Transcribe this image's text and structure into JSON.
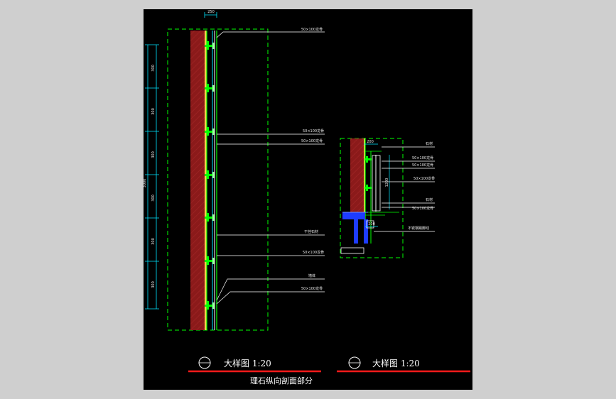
{
  "colors": {
    "background": "#cfcfcf",
    "sheet": "#000000",
    "cut_line": "#00ff00",
    "dim_line": "#00e5ff",
    "label": "#e8e8e8",
    "wall_hatch": "#8b1a1a",
    "steel_channel": "#1e3cff",
    "title_underline": "#ff1a1a"
  },
  "left_detail": {
    "top_dimension": "250",
    "total_dimension": "3000",
    "spacing_labels": [
      "300",
      "300",
      "300",
      "300",
      "300",
      "300"
    ],
    "callouts": [
      "50×100龙骨",
      "50×100龙骨",
      "50×100龙骨",
      "干挂石材",
      "50×100龙骨",
      "墙体",
      "50×100龙骨"
    ],
    "title": "大样图  1:20"
  },
  "right_detail": {
    "top_dimension": "200",
    "side_dimension": "1200",
    "bottom_dimension": "200",
    "callouts": [
      "石材",
      "50×100龙骨",
      "50×100龙骨",
      "50×100龙骨",
      "石材",
      "50×100龙骨",
      "不锈钢踢脚线"
    ],
    "title": "大样图  1:20"
  },
  "bottom_caption": "理石纵向剖面部分"
}
